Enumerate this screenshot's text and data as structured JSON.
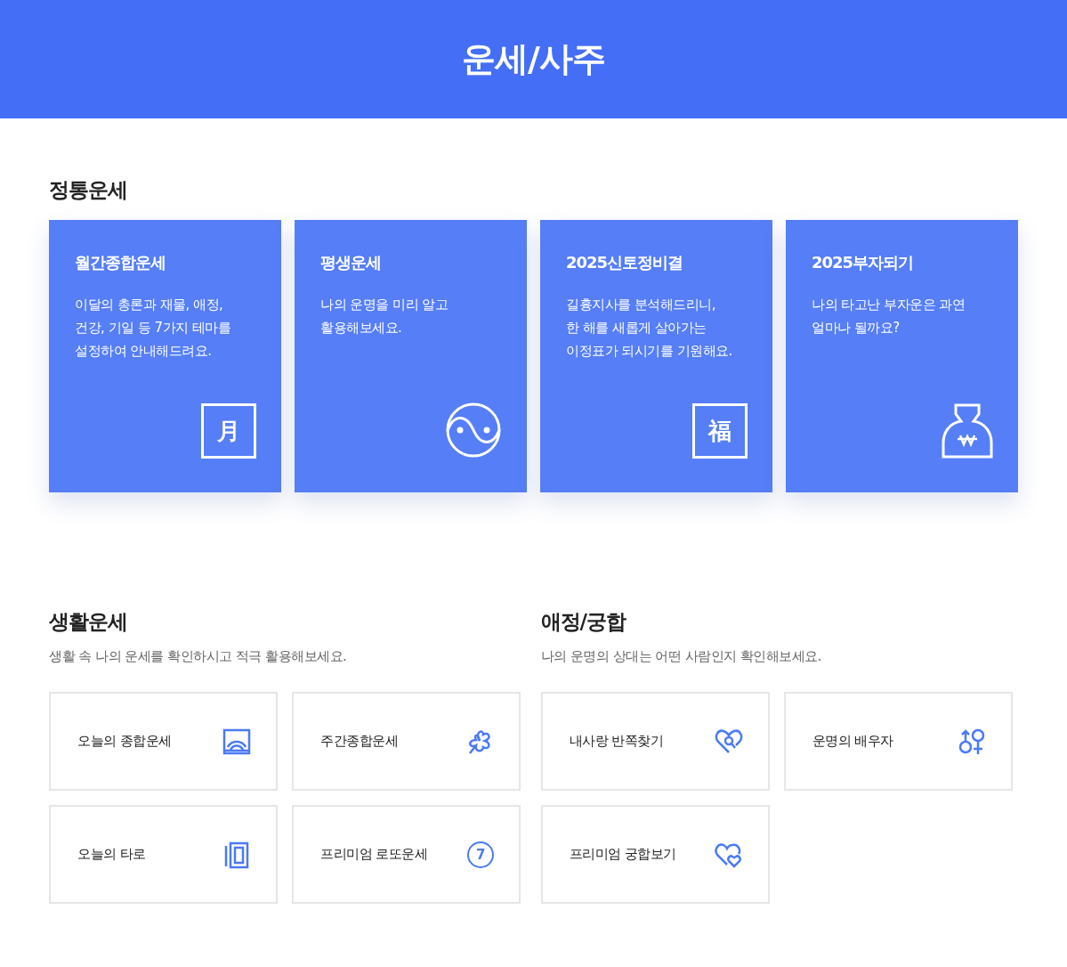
{
  "header": {
    "title": "운세/사주"
  },
  "main_section": {
    "title": "정통운세",
    "cards": [
      {
        "title": "월간종합운세",
        "description": "이달의 총론과 재물, 애정,\n건강, 기일 등 7가지 테마를\n설정하여 안내해드려요.",
        "kind": "glyph",
        "glyph": "月"
      },
      {
        "title": "평생운세",
        "description": "나의 운명을 미리 알고\n활용해보세요.",
        "kind": "yinyang"
      },
      {
        "title": "2025신토정비결",
        "description": "길흉지사를 분석해드리니,\n한 해를 새롭게 살아가는\n이정표가 되시기를 기원해요.",
        "kind": "glyph",
        "glyph": "福"
      },
      {
        "title": "2025부자되기",
        "description": "나의 타고난 부자운은 과연\n얼마나 될까요?",
        "kind": "pouch"
      }
    ]
  },
  "sections": [
    {
      "title": "생활운세",
      "subtitle": "생활 속 나의 운세를 확인하시고 적극 활용해보세요.",
      "items": [
        {
          "label": "오늘의 종합운세",
          "kind": "sunrise"
        },
        {
          "label": "주간종합운세",
          "kind": "clover"
        },
        {
          "label": "오늘의 타로",
          "kind": "cards"
        },
        {
          "label": "프리미엄 로또운세",
          "kind": "number",
          "glyph": "7"
        }
      ]
    },
    {
      "title": "애정/궁합",
      "subtitle": "나의 운명의 상대는 어떤 사람인지 확인해보세요.",
      "items": [
        {
          "label": "내사랑 반쪽찾기",
          "kind": "heartsearch"
        },
        {
          "label": "운명의 배우자",
          "kind": "gender"
        },
        {
          "label": "프리미엄 궁합보기",
          "kind": "hearts"
        }
      ]
    }
  ]
}
